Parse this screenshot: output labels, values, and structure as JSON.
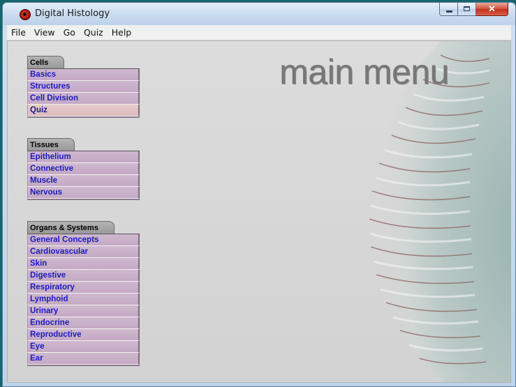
{
  "window": {
    "title": "Digital Histology"
  },
  "menubar": {
    "items": [
      "File",
      "View",
      "Go",
      "Quiz",
      "Help"
    ]
  },
  "main": {
    "title": "main menu"
  },
  "sections": [
    {
      "label": "Cells",
      "items": [
        "Basics",
        "Structures",
        "Cell Division",
        "Quiz"
      ]
    },
    {
      "label": "Tissues",
      "items": [
        "Epithelium",
        "Connective",
        "Muscle",
        "Nervous"
      ]
    },
    {
      "label": "Organs & Systems",
      "items": [
        "General Concepts",
        "Cardiovascular",
        "Skin",
        "Digestive",
        "Respiratory",
        "Lymphoid",
        "Urinary",
        "Endocrine",
        "Reproductive",
        "Eye",
        "Ear"
      ]
    }
  ],
  "colors": {
    "item_bg": "#c8aec8",
    "item_text": "#1a1ac0",
    "quiz_bg": "#e1c4c4",
    "desktop": "#16656a",
    "title_gray": "#777777"
  }
}
